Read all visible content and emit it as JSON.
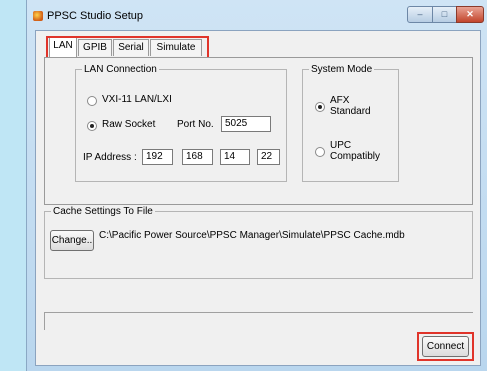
{
  "window": {
    "title": "PPSC Studio Setup",
    "min_glyph": "–",
    "max_glyph": "□",
    "close_glyph": "✕"
  },
  "tabs": [
    {
      "label": "LAN",
      "active": true
    },
    {
      "label": "GPIB",
      "active": false
    },
    {
      "label": "Serial",
      "active": false
    },
    {
      "label": "Simulate",
      "active": false
    }
  ],
  "lan": {
    "group_label": "LAN Connection",
    "option_vxi": "VXI-11 LAN/LXI",
    "option_raw": "Raw Socket",
    "selected": "Raw Socket",
    "port_label": "Port No.",
    "port_value": "5025",
    "ip_label": "IP Address :",
    "ip": [
      "192",
      "168",
      "14",
      "22"
    ]
  },
  "system_mode": {
    "group_label": "System Mode",
    "option_afx": "AFX Standard",
    "option_upc": "UPC Compatibly",
    "selected": "AFX Standard"
  },
  "cache": {
    "group_label": "Cache Settings To File",
    "change_label": "Change..",
    "path": "C:\\Pacific Power Source\\PPSC Manager\\Simulate\\PPSC Cache.mdb"
  },
  "connect_label": "Connect",
  "colors": {
    "highlight": "#e0342a",
    "background": "#bfe6f5"
  }
}
